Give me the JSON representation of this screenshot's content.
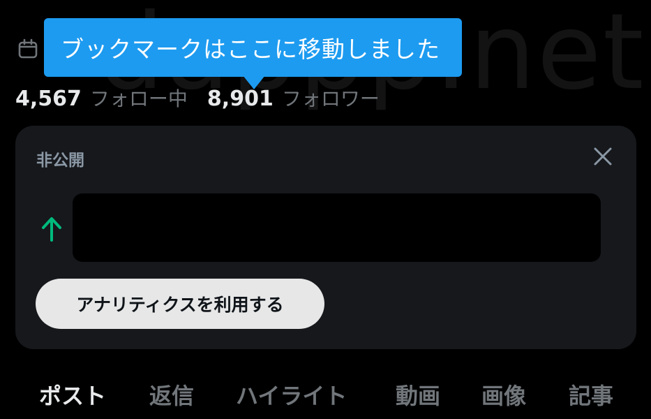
{
  "watermark": {
    "text": "dappp.net"
  },
  "tooltip": {
    "text": "ブックマークはここに移動しました"
  },
  "stats": {
    "following_count": "4,567",
    "following_label": "フォロー中",
    "followers_count": "8,901",
    "followers_label": "フォロワー"
  },
  "analytics_card": {
    "title": "非公開",
    "button_label": "アナリティクスを利用する",
    "trend_color": "#00ba7c"
  },
  "tabs": [
    {
      "label": "ポスト",
      "active": true
    },
    {
      "label": "返信",
      "active": false
    },
    {
      "label": "ハイライト",
      "active": false
    },
    {
      "label": "動画",
      "active": false
    },
    {
      "label": "画像",
      "active": false
    },
    {
      "label": "記事",
      "active": false
    }
  ],
  "colors": {
    "accent": "#1d9bf0",
    "background": "#000000",
    "card": "#16181c",
    "muted_text": "#71767b"
  }
}
